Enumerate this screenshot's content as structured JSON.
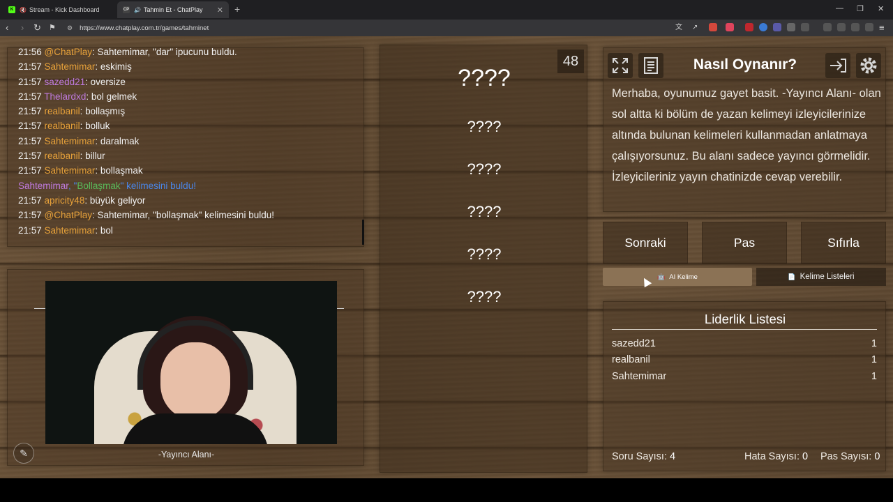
{
  "browser": {
    "tabs": [
      {
        "title": "Stream - Kick Dashboard",
        "favicon_color": "#53fc18"
      },
      {
        "title": "Tahmin Et - ChatPlay",
        "favicon_text": "CP",
        "favicon_color": "#2b2b2b",
        "active": true
      }
    ],
    "url": "https://www.chatplay.com.tr/games/tahminet"
  },
  "chat": {
    "lines": [
      {
        "time": "21:56",
        "user": "@ChatPlay",
        "user_color": "#e8a23a",
        "text": ": Sahtemimar, \"dar\" ipucunu buldu."
      },
      {
        "time": "21:57",
        "user": "Sahtemimar",
        "user_color": "#e8a23a",
        "text": ": eskimiş"
      },
      {
        "time": "21:57",
        "user": "sazedd21",
        "user_color": "#c07be0",
        "text": ": oversize"
      },
      {
        "time": "21:57",
        "user": "Thelardxd",
        "user_color": "#c07be0",
        "text": ": bol gelmek"
      },
      {
        "time": "21:57",
        "user": "realbanil",
        "user_color": "#e8a23a",
        "text": ": bollaşmış"
      },
      {
        "time": "21:57",
        "user": "realbanil",
        "user_color": "#e8a23a",
        "text": ": bolluk"
      },
      {
        "time": "21:57",
        "user": "Sahtemimar",
        "user_color": "#e8a23a",
        "text": ": daralmak"
      },
      {
        "time": "21:57",
        "user": "realbanil",
        "user_color": "#e8a23a",
        "text": ": billur"
      },
      {
        "time": "21:57",
        "user": "Sahtemimar",
        "user_color": "#e8a23a",
        "text": ": bollaşmak"
      },
      {
        "system": true,
        "user": "Sahtemimar",
        "pre": ", \"",
        "word": "Bollaşmak",
        "post": "\" kelimesini buldu!"
      },
      {
        "time": "21:57",
        "user": "apricity48",
        "user_color": "#e8a23a",
        "text": ": büyük geliyor"
      },
      {
        "time": "21:57",
        "user": "@ChatPlay",
        "user_color": "#e8a23a",
        "text": ": Sahtemimar, \"bollaşmak\" kelimesini buldu!"
      },
      {
        "time": "21:57",
        "user": "Sahtemimar",
        "user_color": "#e8a23a",
        "text": ": bol"
      }
    ]
  },
  "streamer": {
    "label": "-Yayıncı Alanı-",
    "pen_icon": "pen-icon"
  },
  "game": {
    "timer": "48",
    "words": [
      "????",
      "????",
      "????",
      "????",
      "????",
      "????"
    ]
  },
  "howto": {
    "title": "Nasıl Oynanır?",
    "text": "Merhaba, oyunumuz gayet basit. -Yayıncı Alanı- olan sol altta ki bölüm de yazan kelimeyi izleyicilerinize altında bulunan kelimeleri kullanmadan anlatmaya çalışıyorsunuz. Bu alanı sadece yayıncı görmelidir. İzleyicileriniz yayın chatinizde cevap verebilir."
  },
  "actions": {
    "next": "Sonraki",
    "pass": "Pas",
    "reset": "Sıfırla"
  },
  "word_tabs": {
    "ai": "AI Kelime",
    "lists": "Kelime Listeleri"
  },
  "leaderboard": {
    "title": "Liderlik Listesi",
    "rows": [
      {
        "name": "sazedd21",
        "score": "1"
      },
      {
        "name": "realbanil",
        "score": "1"
      },
      {
        "name": "Sahtemimar",
        "score": "1"
      }
    ]
  },
  "stats": {
    "questions_label": "Soru Sayısı:",
    "questions": "4",
    "errors_label": "Hata Sayısı:",
    "errors": "0",
    "passes_label": "Pas Sayısı:",
    "passes": "0"
  }
}
